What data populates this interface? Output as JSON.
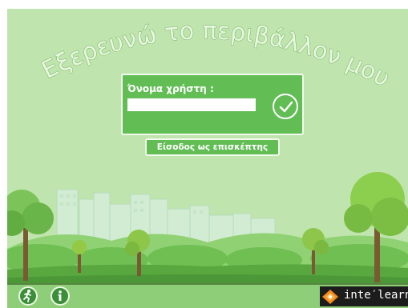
{
  "title": "Εξερευνώ το περιβάλλον μου",
  "login": {
    "username_label": "Όνομα χρήστη :",
    "username_value": "",
    "confirm_icon": "checkmark-circle-icon"
  },
  "guest_button_label": "Είσοδος ως επισκέπτης",
  "footer": {
    "exit_icon": "running-person-icon",
    "info_icon": "info-icon",
    "brand_text": "inte′learn"
  },
  "colors": {
    "background": "#bfe4ad",
    "panel": "#62bd55",
    "footer": "#8fce78",
    "button_dark": "#3c8e3a"
  }
}
